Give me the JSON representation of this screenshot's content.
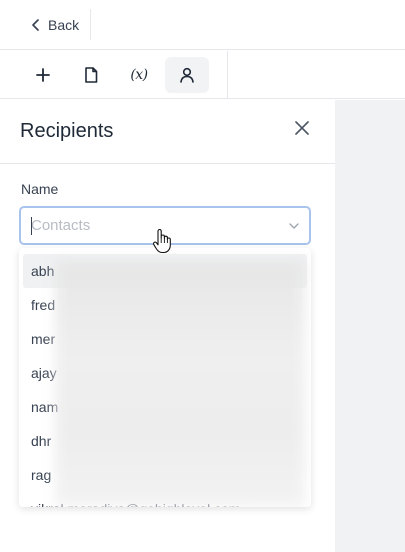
{
  "topbar": {
    "back_label": "Back"
  },
  "toolbar": {
    "tools": [
      {
        "name": "add",
        "icon": "plus-icon"
      },
      {
        "name": "document",
        "icon": "document-icon"
      },
      {
        "name": "variable",
        "label": "(x)"
      },
      {
        "name": "user",
        "icon": "user-icon"
      }
    ]
  },
  "panel": {
    "title": "Recipients",
    "name_label": "Name",
    "contacts_placeholder": "Contacts"
  },
  "dropdown": {
    "options": [
      "abh",
      "fred",
      "mer",
      "ajay",
      "nam",
      "dhr",
      "rag",
      "vikral.moradiya@gohighlevel.com"
    ]
  },
  "colors": {
    "focus_border": "#a9c4ec",
    "canvas_bg": "#f1f2f4"
  }
}
